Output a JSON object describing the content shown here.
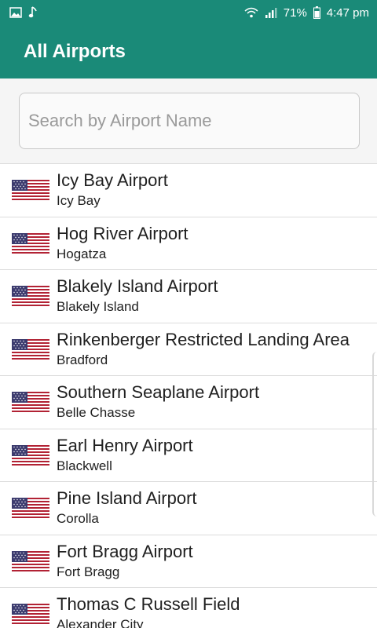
{
  "status_bar": {
    "battery": "71%",
    "time": "4:47 pm",
    "icons": [
      "image-icon",
      "music-note-icon",
      "wifi-icon",
      "signal-icon",
      "battery-icon"
    ]
  },
  "app_bar": {
    "title": "All Airports"
  },
  "search": {
    "placeholder": "Search by Airport Name",
    "value": ""
  },
  "flag_icon": "us-flag-icon",
  "colors": {
    "primary": "#1a8a78",
    "divider": "#dcdcdc"
  },
  "airports": [
    {
      "name": "Icy Bay Airport",
      "city": "Icy Bay"
    },
    {
      "name": "Hog River Airport",
      "city": "Hogatza"
    },
    {
      "name": "Blakely Island Airport",
      "city": "Blakely Island"
    },
    {
      "name": "Rinkenberger Restricted Landing Area",
      "city": "Bradford"
    },
    {
      "name": "Southern Seaplane Airport",
      "city": "Belle Chasse"
    },
    {
      "name": "Earl Henry Airport",
      "city": "Blackwell"
    },
    {
      "name": "Pine Island Airport",
      "city": "Corolla"
    },
    {
      "name": "Fort Bragg Airport",
      "city": "Fort Bragg"
    },
    {
      "name": "Thomas C Russell Field",
      "city": "Alexander City"
    }
  ]
}
